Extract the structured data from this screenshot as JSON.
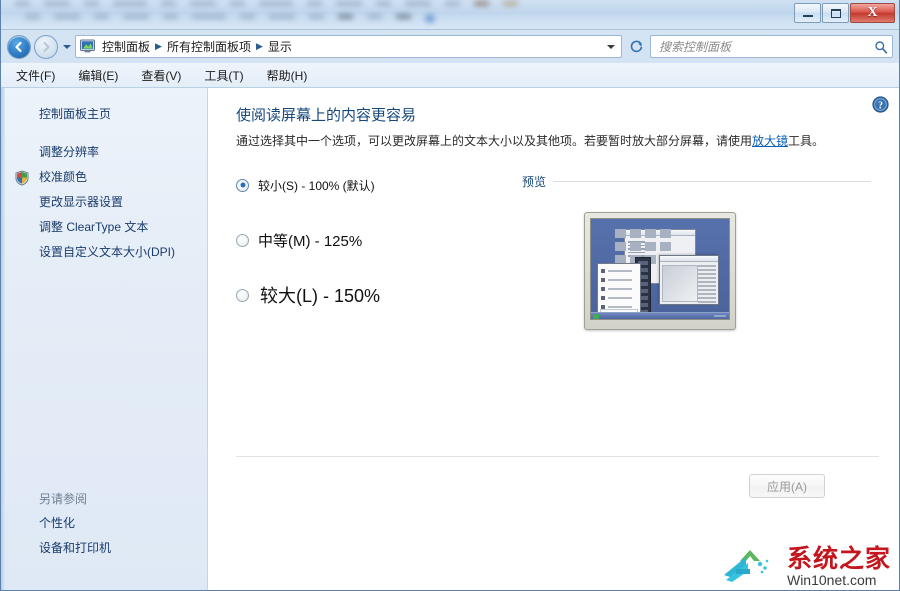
{
  "window": {
    "controls": {
      "minimize": "minimize-button",
      "maximize": "maximize-button",
      "close_glyph": "X"
    }
  },
  "nav": {
    "back_tooltip": "后退",
    "forward_tooltip": "前进",
    "breadcrumbs": [
      "控制面板",
      "所有控制面板项",
      "显示"
    ],
    "separator": "▶",
    "refresh_icon": "refresh-icon"
  },
  "search": {
    "placeholder": "搜索控制面板",
    "value": "",
    "icon": "search-icon"
  },
  "menubar": {
    "items": [
      "文件(F)",
      "编辑(E)",
      "查看(V)",
      "工具(T)",
      "帮助(H)"
    ]
  },
  "sidebar": {
    "home": "控制面板主页",
    "items": [
      {
        "label": "调整分辨率",
        "icon": null
      },
      {
        "label": "校准颜色",
        "icon": "shield-icon"
      },
      {
        "label": "更改显示器设置",
        "icon": null
      },
      {
        "label": "调整 ClearType 文本",
        "icon": null
      },
      {
        "label": "设置自定义文本大小(DPI)",
        "icon": null
      }
    ],
    "see_also_header": "另请参阅",
    "see_also": [
      "个性化",
      "设备和打印机"
    ]
  },
  "content": {
    "help_icon": "help-icon",
    "title": "使阅读屏幕上的内容更容易",
    "desc_before": "通过选择其中一个选项，可以更改屏幕上的文本大小以及其他项。若要暂时放大部分屏幕，请使用",
    "desc_link": "放大镜",
    "desc_after": "工具。",
    "options": [
      {
        "label": "较小(S) - 100% (默认)",
        "selected": true
      },
      {
        "label": "中等(M) - 125%",
        "selected": false
      },
      {
        "label": "较大(L) - 150%",
        "selected": false
      }
    ],
    "preview_label": "预览",
    "apply_label": "应用(A)"
  },
  "watermark": {
    "cn": "系统之家",
    "en": "Win10net.com"
  }
}
